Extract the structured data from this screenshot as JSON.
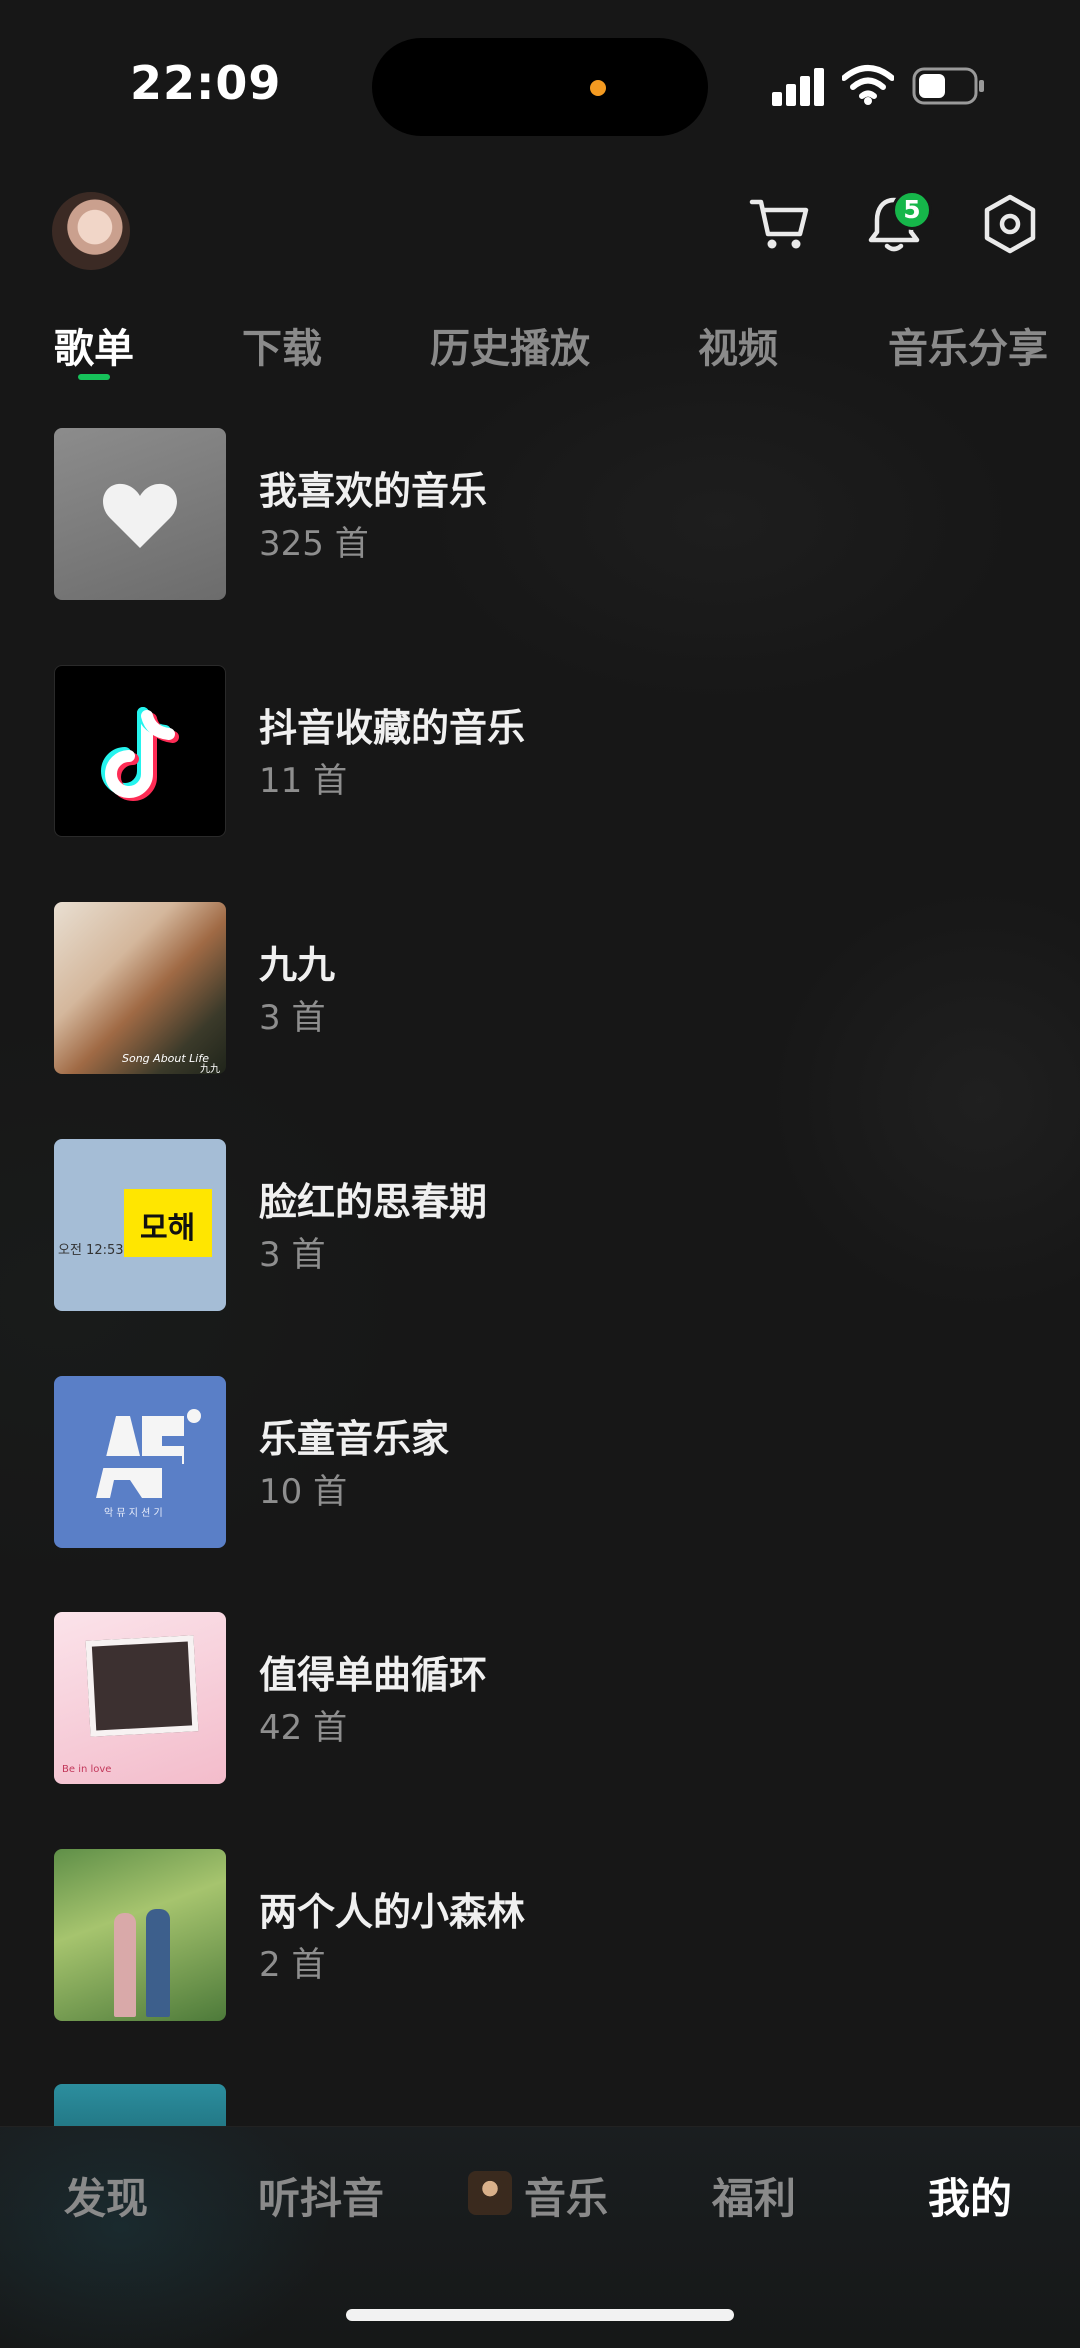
{
  "status_bar": {
    "time": "22:09"
  },
  "header": {
    "notification_count": "5",
    "icons": [
      "avatar",
      "cart-icon",
      "bell-icon",
      "settings-icon"
    ]
  },
  "tabs": [
    {
      "label": "歌单",
      "active": true
    },
    {
      "label": "下载",
      "active": false
    },
    {
      "label": "历史播放",
      "active": false
    },
    {
      "label": "视频",
      "active": false
    },
    {
      "label": "音乐分享",
      "active": false
    }
  ],
  "playlists": [
    {
      "title": "我喜欢的音乐",
      "count": "325 首",
      "cover": "heart-icon"
    },
    {
      "title": "抖音收藏的音乐",
      "count": "11 首",
      "cover": "douyin-logo"
    },
    {
      "title": "九九",
      "count": "3 首",
      "cover": "album-art",
      "cover_text": [
        "Song About Life",
        "九九"
      ]
    },
    {
      "title": "脸红的思春期",
      "count": "3 首",
      "cover": "album-art",
      "cover_text": [
        "모해",
        "오전 12:53"
      ]
    },
    {
      "title": "乐童音乐家",
      "count": "10 首",
      "cover": "album-art",
      "cover_text": [
        "악 뮤 지 션 기"
      ]
    },
    {
      "title": "值得单曲循环",
      "count": "42 首",
      "cover": "album-art",
      "cover_text": [
        "Be in love"
      ]
    },
    {
      "title": "两个人的小森林",
      "count": "2 首",
      "cover": "album-art"
    }
  ],
  "bottom_nav": [
    {
      "label": "发现",
      "active": false
    },
    {
      "label": "听抖音",
      "active": false
    },
    {
      "label": "音乐",
      "active": false
    },
    {
      "label": "福利",
      "active": false
    },
    {
      "label": "我的",
      "active": true
    }
  ],
  "colors": {
    "background": "#171717",
    "accent": "#16c25a",
    "badge": "#16b64a",
    "muted_text": "#8e8e8e"
  }
}
